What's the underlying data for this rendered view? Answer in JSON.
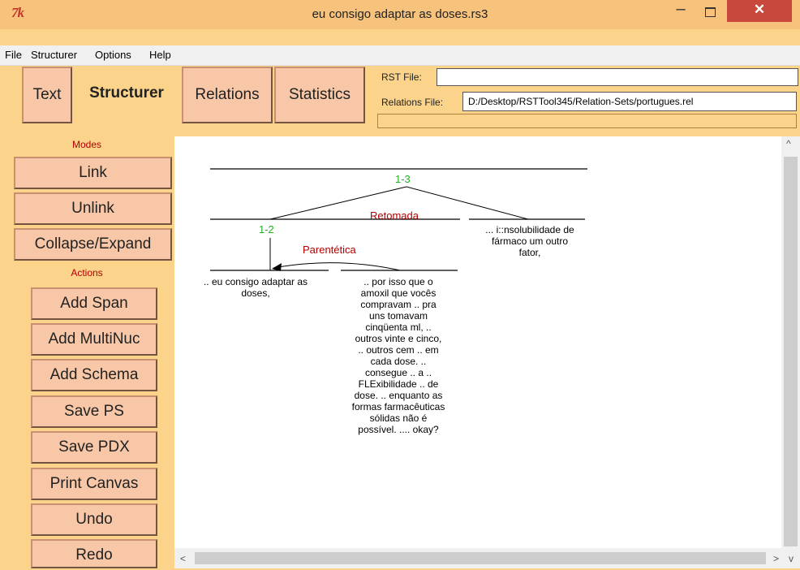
{
  "window": {
    "app_icon": "7k",
    "title": "eu consigo adaptar as doses.rs3",
    "minimize": "–",
    "close": "✕"
  },
  "menu": [
    "File",
    "Structurer",
    "Options",
    "Help"
  ],
  "tabs": [
    "Text",
    "Structurer",
    "Relations",
    "Statistics"
  ],
  "files": {
    "rst_label": "RST File:",
    "rst_value": "",
    "relations_label": "Relations File:",
    "relations_value": "D:/Desktop/RSTTool345/Relation-Sets/portugues.rel"
  },
  "sidebar": {
    "modes_label": "Modes",
    "modes": [
      "Link",
      "Unlink",
      "Collapse/Expand"
    ],
    "actions_label": "Actions",
    "actions": [
      "Add Span",
      "Add MultiNuc",
      "Add Schema",
      "Save PS",
      "Save PDX",
      "Print Canvas",
      "Undo",
      "Redo"
    ]
  },
  "diagram": {
    "span_top": "1-3",
    "span_inner": "1-2",
    "relation_outer": "Retomada",
    "relation_inner": "Parentética",
    "segment1": ".. eu consigo adaptar as doses,",
    "segment2_lines": [
      ".. por isso que o",
      "amoxil que vocês",
      "compravam .. pra",
      "uns tomavam",
      "cinqüenta ml, ..",
      "outros vinte e cinco,",
      ".. outros cem .. em",
      "cada dose. ..",
      "consegue .. a ..",
      "FLExibilidade .. de",
      "dose. .. enquanto as",
      "formas farmacêuticas",
      "sólidas não é",
      "possível. .... okay?"
    ],
    "segment3_lines": [
      "... i::nsolubilidade de",
      "fármaco um outro",
      "fator,"
    ]
  },
  "scroll": {
    "up": "^",
    "left": "<",
    "right": ">",
    "down": "v"
  },
  "colors": {
    "window_bg": "#fbd38a",
    "button_bg": "#f7c7a7",
    "relation_color": "#b00000",
    "span_color": "#22b022",
    "close_red": "#c9483c"
  }
}
